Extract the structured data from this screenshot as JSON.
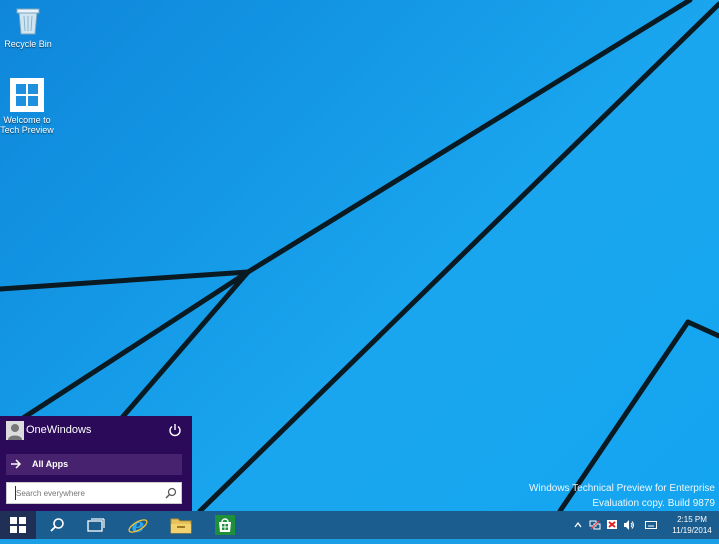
{
  "desktop": {
    "icons": [
      {
        "label": "Recycle Bin",
        "icon": "recycle-bin-icon"
      },
      {
        "label": "Welcome to Tech Preview",
        "icon": "windows-logo-icon"
      }
    ],
    "watermark": {
      "line1": "Windows Technical Preview for Enterprise",
      "line2": "Evaluation copy. Build 9879"
    }
  },
  "start_menu": {
    "username": "OneWindows",
    "all_apps_label": "All Apps",
    "search_placeholder": "Search everywhere",
    "background_color": "#2b0a5a"
  },
  "taskbar": {
    "pinned": [
      "search-icon",
      "task-view-icon",
      "internet-explorer-icon",
      "file-explorer-icon",
      "store-icon"
    ],
    "tray": [
      "show-hidden-icons-icon",
      "network-icon",
      "action-center-flag-icon",
      "volume-icon",
      "keyboard-icon"
    ],
    "clock": {
      "time": "2:15 PM",
      "date": "11/19/2014"
    },
    "color": "#1c5d8f"
  }
}
